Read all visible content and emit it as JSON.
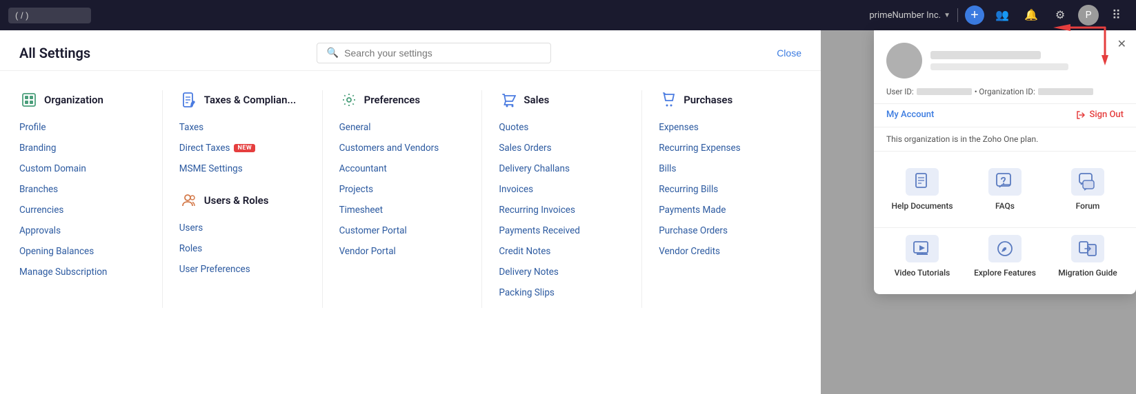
{
  "topnav": {
    "search_placeholder": "( / )",
    "company_name": "primeNumber Inc.",
    "icons": {
      "plus": "+",
      "people": "👥",
      "bell": "🔔",
      "gear": "⚙",
      "grid": "⠿"
    }
  },
  "settings": {
    "title": "All Settings",
    "search_placeholder": "Search your settings",
    "close_label": "Close",
    "columns": {
      "organization": {
        "title": "Organization",
        "icon": "🏢",
        "items": [
          "Profile",
          "Branding",
          "Custom Domain",
          "Branches",
          "Currencies",
          "Approvals",
          "Opening Balances",
          "Manage Subscription"
        ]
      },
      "taxes": {
        "title": "Taxes & Complian...",
        "icon": "📋",
        "items": [
          "Taxes",
          "Direct Taxes",
          "MSME Settings"
        ],
        "new_badge_on": "Direct Taxes",
        "sections": {
          "users_roles": {
            "title": "Users & Roles",
            "icon": "👤",
            "items": [
              "Users",
              "Roles",
              "User Preferences"
            ]
          }
        }
      },
      "preferences": {
        "title": "Preferences",
        "icon": "⚙",
        "items": [
          "General",
          "Customers and Vendors",
          "Accountant",
          "Projects",
          "Timesheet",
          "Customer Portal",
          "Vendor Portal"
        ]
      },
      "sales": {
        "title": "Sales",
        "icon": "🛒",
        "items": [
          "Quotes",
          "Sales Orders",
          "Delivery Challans",
          "Invoices",
          "Recurring Invoices",
          "Payments Received",
          "Credit Notes",
          "Delivery Notes",
          "Packing Slips"
        ]
      },
      "purchases": {
        "title": "Purchases",
        "icon": "🛍",
        "items": [
          "Expenses",
          "Recurring Expenses",
          "Bills",
          "Recurring Bills",
          "Payments Made",
          "Purchase Orders",
          "Vendor Credits"
        ]
      }
    }
  },
  "profile_popup": {
    "user_id_label": "User ID:",
    "org_id_label": "• Organization ID:",
    "my_account_label": "My Account",
    "sign_out_label": "Sign Out",
    "org_plan_text": "This organization is in the Zoho One plan.",
    "resources": [
      {
        "icon": "📄",
        "label": "Help Documents"
      },
      {
        "icon": "❓",
        "label": "FAQs"
      },
      {
        "icon": "💬",
        "label": "Forum"
      },
      {
        "icon": "▶",
        "label": "Video Tutorials"
      },
      {
        "icon": "🔍",
        "label": "Explore Features"
      },
      {
        "icon": "📦",
        "label": "Migration Guide"
      }
    ]
  }
}
